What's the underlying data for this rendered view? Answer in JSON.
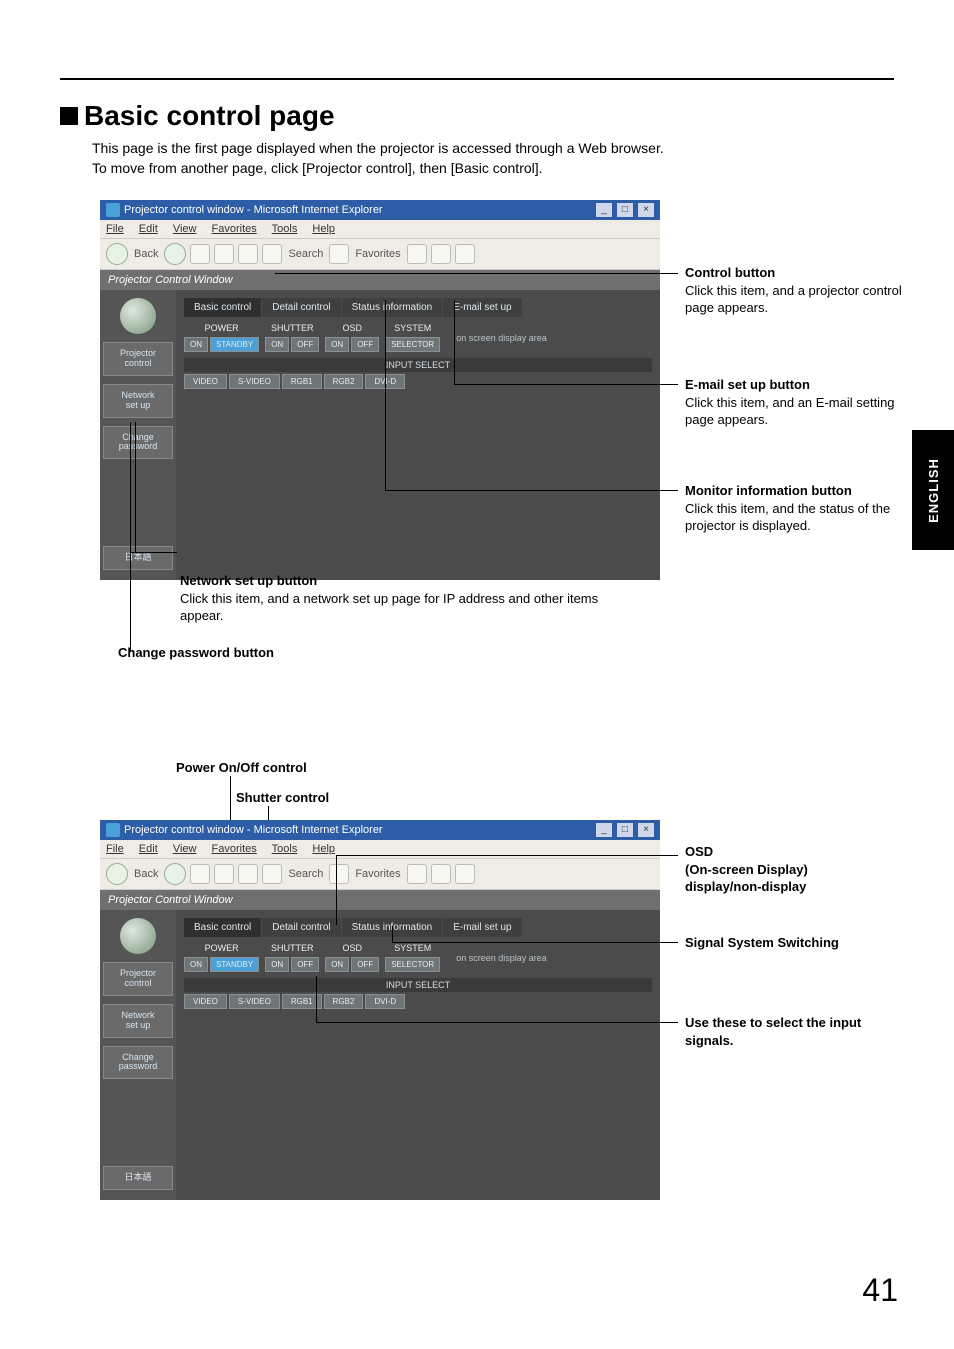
{
  "page": {
    "title": "Basic control page",
    "intro_l1": "This page is the first page displayed when the projector is accessed through a Web browser.",
    "intro_l2": "To move from another page, click [Projector control], then [Basic control].",
    "number": "41",
    "english_tab": "ENGLISH"
  },
  "browser": {
    "window_title": "Projector control window - Microsoft Internet Explorer",
    "menus": {
      "file": "File",
      "edit": "Edit",
      "view": "View",
      "favorites": "Favorites",
      "tools": "Tools",
      "help": "Help"
    },
    "toolbar": {
      "back": "Back",
      "search": "Search",
      "favorites": "Favorites"
    },
    "pcw_title": "Projector Control Window"
  },
  "sidebar": {
    "projector_control": "Projector\ncontrol",
    "network_setup": "Network\nset up",
    "change_password": "Change\npassword",
    "japanese": "日本語"
  },
  "tabs": {
    "basic": "Basic control",
    "detail": "Detail control",
    "status": "Status information",
    "email": "E-mail set up"
  },
  "controls": {
    "power": "POWER",
    "shutter": "SHUTTER",
    "osd": "OSD",
    "system": "SYSTEM",
    "on": "ON",
    "standby": "STANDBY",
    "off": "OFF",
    "selector": "SELECTOR",
    "input_select": "INPUT SELECT",
    "video": "VIDEO",
    "svideo": "S-VIDEO",
    "rgb1": "RGB1",
    "rgb2": "RGB2",
    "dvid": "DVI-D",
    "on_screen": "on screen display area"
  },
  "callouts": {
    "control_btn_hd": "Control button",
    "control_btn_tx": "Click this item, and a projector control page appears.",
    "email_hd": "E-mail set up button",
    "email_tx": "Click this item, and an E-mail setting page appears.",
    "monitor_hd": "Monitor information button",
    "monitor_tx": "Click this item, and the status of the projector is displayed.",
    "network_hd": "Network set up button",
    "network_tx": "Click this item, and a network set up page for IP address and other items appear.",
    "changepw_hd": "Change password button",
    "power_hd": "Power On/Off control",
    "shutter_hd": "Shutter control",
    "osd_hd": "OSD",
    "osd_l1": "(On-screen Display)",
    "osd_l2": "display/non-display",
    "signal_hd": "Signal System Switching",
    "inputs_hd": "Use these to select the input signals."
  }
}
